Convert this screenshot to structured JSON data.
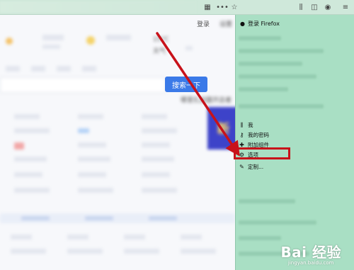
{
  "toolbar": {
    "icons": [
      "qr-code-icon",
      "more-icon",
      "bookmark-star-icon",
      "library-icon",
      "sidebar-icon",
      "account-icon",
      "hamburger-menu-icon"
    ]
  },
  "page": {
    "nav_login": "登录",
    "nav_settings": "设置",
    "weather_temp": "15°C",
    "weather_label": "天气",
    "search_button": "搜索一下",
    "promo_snippet": "哪里扎加盟开店者",
    "promo_text": "新"
  },
  "panel": {
    "signin_label": "登录 Firefox",
    "items": [
      {
        "label": "我",
        "icon": "library-icon"
      },
      {
        "label": "我的密码",
        "icon": "key-icon"
      },
      {
        "label": "附加组件",
        "icon": "puzzle-icon"
      },
      {
        "label": "选项",
        "icon": "gear-icon"
      },
      {
        "label": "定制...",
        "icon": "brush-icon"
      }
    ]
  },
  "watermark": {
    "logo": "Bai 经验",
    "url": "jingyan.baidu.com"
  },
  "colors": {
    "toolbar_bg": "#cfe8da",
    "panel_bg": "#a9dfc4",
    "annotation_red": "#c8121a",
    "search_blue": "#3b7ae8"
  }
}
